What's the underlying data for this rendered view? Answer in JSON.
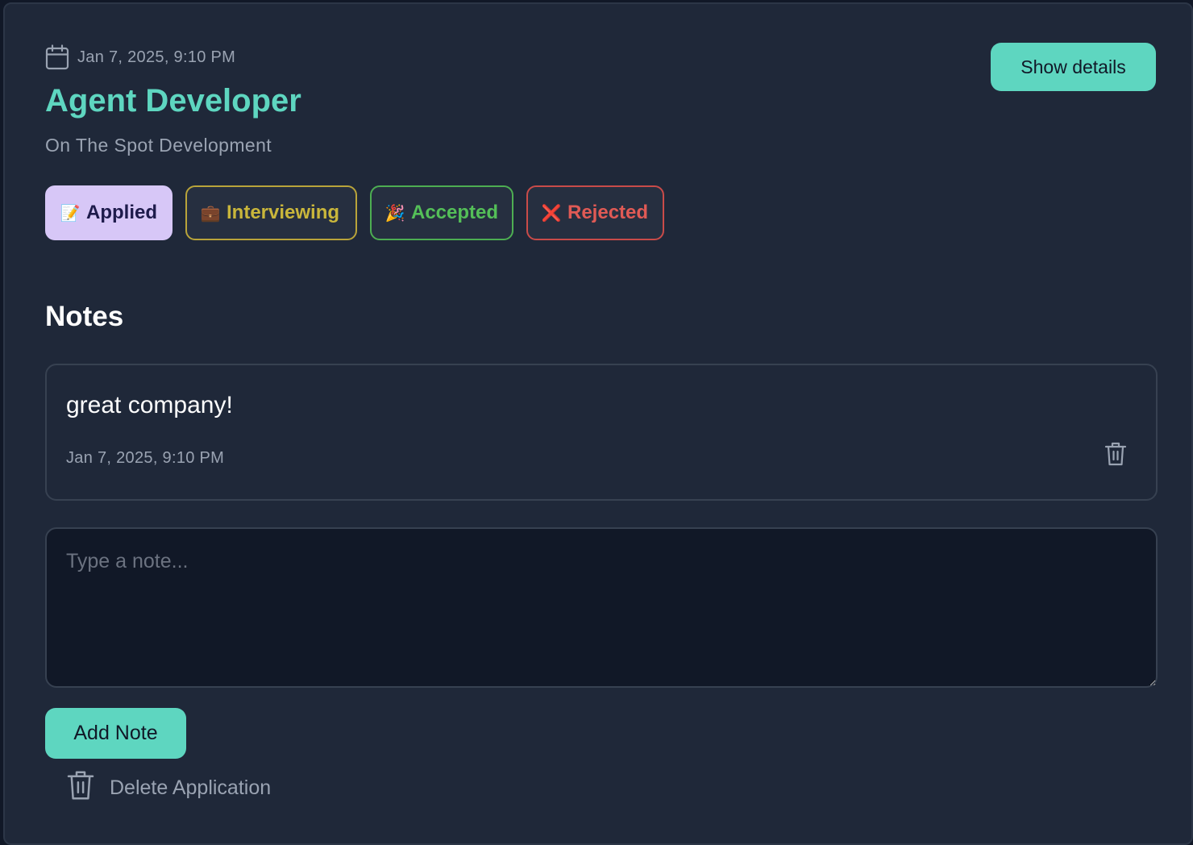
{
  "application": {
    "date": "Jan 7, 2025, 9:10 PM",
    "title": "Agent Developer",
    "company": "On The Spot Development",
    "show_details_label": "Show details"
  },
  "statuses": [
    {
      "emoji": "📝",
      "label": "Applied",
      "selected": true,
      "color": "#d7c7f7"
    },
    {
      "emoji": "💼",
      "label": "Interviewing",
      "selected": false,
      "color": "#c9b63b"
    },
    {
      "emoji": "🎉",
      "label": "Accepted",
      "selected": false,
      "color": "#54bf58"
    },
    {
      "emoji": "❌",
      "label": "Rejected",
      "selected": false,
      "color": "#e05a55"
    }
  ],
  "notes": {
    "heading": "Notes",
    "items": [
      {
        "text": "great company!",
        "date": "Jan 7, 2025, 9:10 PM",
        "delete_icon": "trash-icon"
      }
    ],
    "input_placeholder": "Type a note...",
    "add_label": "Add Note"
  },
  "delete_application": {
    "label": "Delete Application",
    "icon": "trash-icon"
  },
  "colors": {
    "accent": "#5ed6c0",
    "card_background": "#1f2839",
    "page_background": "#111827"
  }
}
